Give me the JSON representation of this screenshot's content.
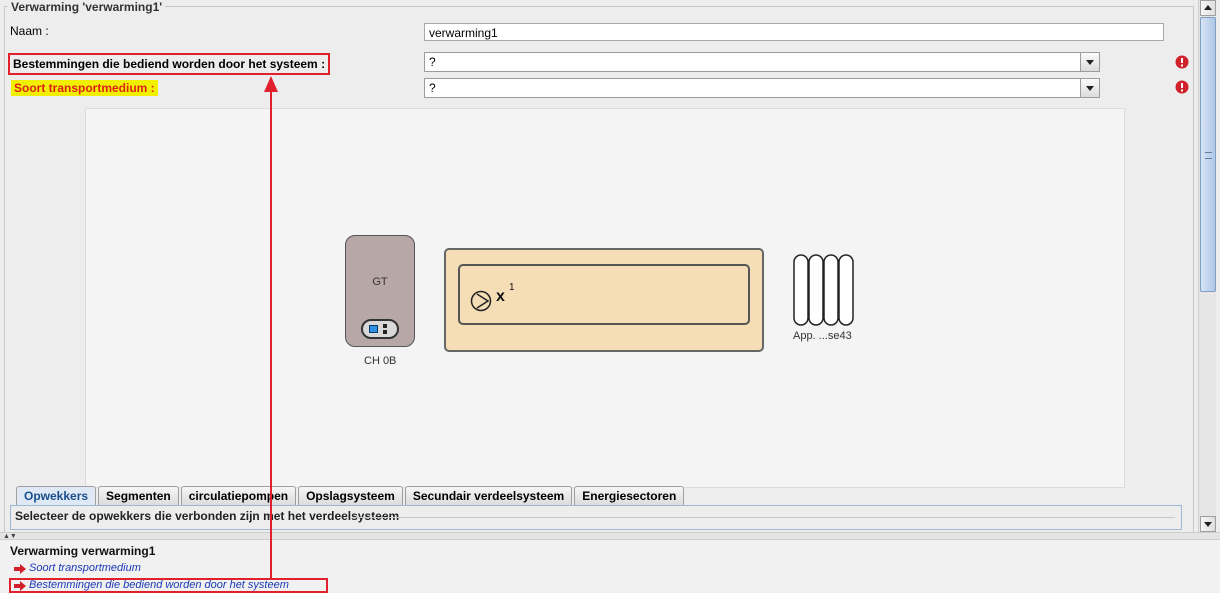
{
  "group_title": "Verwarming 'verwarming1'",
  "fields": {
    "naam_label": "Naam :",
    "naam_value": "verwarming1",
    "bestemmingen_label": "Bestemmingen die bediend worden door het systeem :",
    "bestemmingen_value": "?",
    "soort_label": "Soort transportmedium :",
    "soort_value": "?"
  },
  "diagram": {
    "boiler_code": "GT",
    "boiler_name": "CH 0B",
    "pump_symbol": "x",
    "pump_count": "1",
    "radiator_label": "App. ...se43"
  },
  "tabs": [
    {
      "label": "Opwekkers",
      "active": true
    },
    {
      "label": "Segmenten",
      "active": false
    },
    {
      "label": "circulatiepompen",
      "active": false
    },
    {
      "label": "Opslagsysteem",
      "active": false
    },
    {
      "label": "Secundair verdeelsysteem",
      "active": false
    },
    {
      "label": "Energiesectoren",
      "active": false
    }
  ],
  "tab_panel_title": "Selecteer de opwekkers die verbonden zijn met het verdeelsysteem",
  "bottom": {
    "title": "Verwarming verwarming1",
    "issues": [
      "Soort transportmedium",
      "Bestemmingen die bediend worden door het systeem"
    ]
  },
  "colors": {
    "highlight_red": "#e0202a",
    "highlight_yellow": "#f2f000",
    "error_icon": "#d0202a",
    "issue_link": "#1b38b8",
    "distribution_fill": "#f5deb6",
    "boiler_fill": "#b8a7a7"
  },
  "icons": {
    "error": "exclamation-circle-icon",
    "issue": "red-arrow-icon",
    "pump": "pump-icon",
    "radiator": "radiator-icon"
  }
}
